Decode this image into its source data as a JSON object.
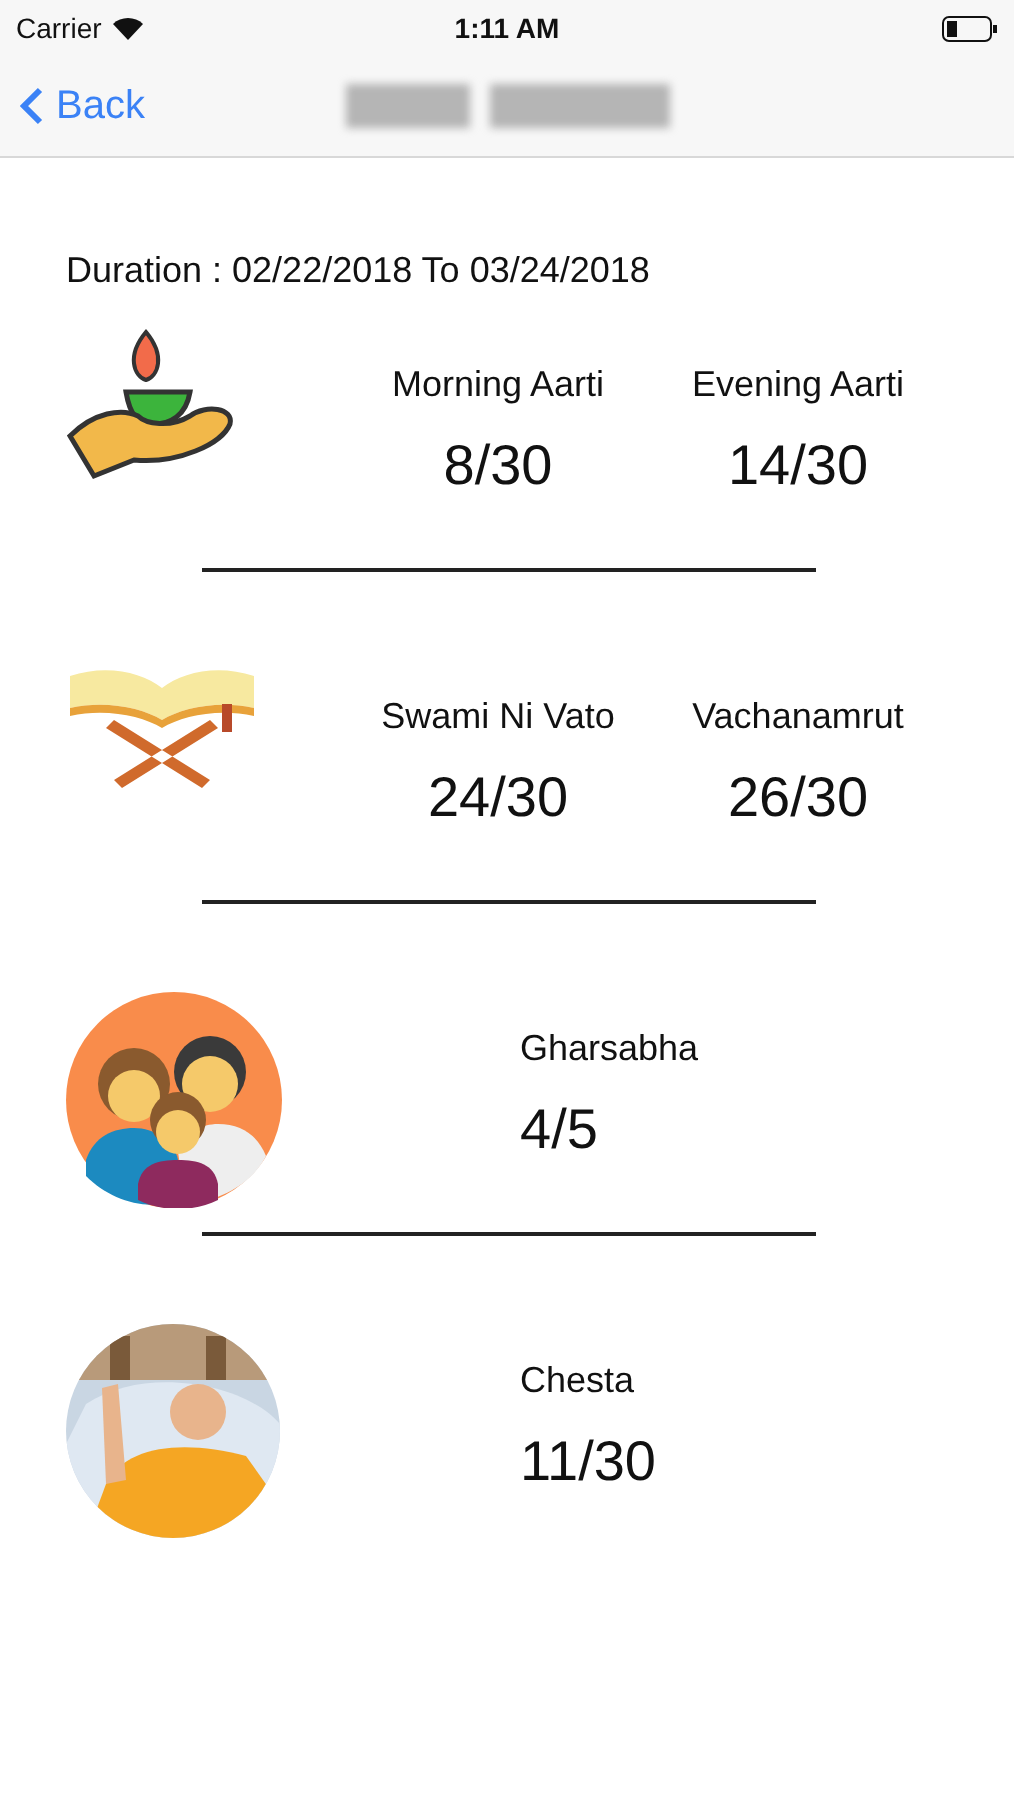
{
  "status_bar": {
    "carrier": "Carrier",
    "time": "1:11 AM"
  },
  "nav_bar": {
    "back": "Back"
  },
  "duration": "Duration : 02/22/2018 To 03/24/2018",
  "sections": [
    {
      "kind": "lamp",
      "stats": [
        {
          "label": "Morning Aarti",
          "value": "8/30"
        },
        {
          "label": "Evening Aarti",
          "value": "14/30"
        }
      ]
    },
    {
      "kind": "book",
      "stats": [
        {
          "label": "Swami Ni Vato",
          "value": "24/30"
        },
        {
          "label": "Vachanamrut",
          "value": "26/30"
        }
      ]
    },
    {
      "kind": "family",
      "stats": [
        {
          "label": "Gharsabha",
          "value": "4/5"
        }
      ]
    },
    {
      "kind": "picture",
      "stats": [
        {
          "label": "Chesta",
          "value": "11/30"
        }
      ]
    }
  ]
}
